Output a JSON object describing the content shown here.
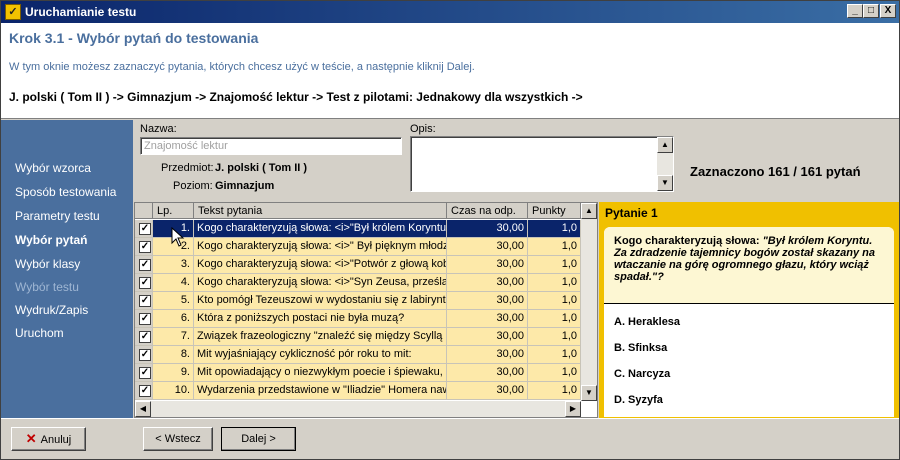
{
  "window": {
    "title": "Uruchamianie testu",
    "controls": [
      "_",
      "□",
      "X"
    ]
  },
  "header": {
    "step_title": "Krok 3.1 - Wybór pytań do testowania",
    "instruction": "W tym oknie możesz zaznaczyć pytania, których chcesz użyć w teście, a następnie kliknij Dalej.",
    "breadcrumb": "J. polski    ( Tom II ) -> Gimnazjum -> Znajomość lektur -> Test z pilotami: Jednakowy dla wszystkich ->"
  },
  "sidebar": {
    "items": [
      {
        "label": "Wybór wzorca",
        "state": "normal"
      },
      {
        "label": "Sposób testowania",
        "state": "normal"
      },
      {
        "label": "Parametry testu",
        "state": "normal"
      },
      {
        "label": "Wybór pytań",
        "state": "active"
      },
      {
        "label": "Wybór klasy",
        "state": "normal"
      },
      {
        "label": "Wybór testu",
        "state": "disabled"
      },
      {
        "label": "Wydruk/Zapis",
        "state": "normal"
      },
      {
        "label": "Uruchom",
        "state": "normal"
      }
    ]
  },
  "form": {
    "name_label": "Nazwa:",
    "name_value": "Znajomość lektur",
    "desc_label": "Opis:",
    "desc_value": "",
    "subject_label": "Przedmiot:",
    "subject_value": "J. polski   ( Tom II )",
    "level_label": "Poziom:",
    "level_value": "Gimnazjum",
    "count_text": "Zaznaczono 161 / 161 pytań"
  },
  "grid": {
    "columns": [
      "Lp.",
      "Tekst pytania",
      "Czas na odp.",
      "Punkty"
    ],
    "selected_row": 0,
    "rows": [
      {
        "checked": true,
        "lp": "1.",
        "text": "Kogo charakteryzują słowa: <i>\"Był królem Koryntu.",
        "time": "30,00",
        "points": "1,0"
      },
      {
        "checked": true,
        "lp": "2.",
        "text": "Kogo charakteryzują słowa: <i>\" Był pięknym młodz",
        "time": "30,00",
        "points": "1,0"
      },
      {
        "checked": true,
        "lp": "3.",
        "text": "Kogo charakteryzują słowa: <i>\"Potwór z głową kob",
        "time": "30,00",
        "points": "1,0"
      },
      {
        "checked": true,
        "lp": "4.",
        "text": "Kogo charakteryzują słowa: <i>\"Syn Zeusa, prześla",
        "time": "30,00",
        "points": "1,0"
      },
      {
        "checked": true,
        "lp": "5.",
        "text": "Kto pomógł Tezeuszowi w wydostaniu się z labiryntu",
        "time": "30,00",
        "points": "1,0"
      },
      {
        "checked": true,
        "lp": "6.",
        "text": "Która z poniższych postaci nie była muzą?",
        "time": "30,00",
        "points": "1,0"
      },
      {
        "checked": true,
        "lp": "7.",
        "text": "Związek frazeologiczny \"znaleźć się między Scyllą a",
        "time": "30,00",
        "points": "1,0"
      },
      {
        "checked": true,
        "lp": "8.",
        "text": "Mit wyjaśniający cykliczność pór roku to mit:",
        "time": "30,00",
        "points": "1,0"
      },
      {
        "checked": true,
        "lp": "9.",
        "text": "Mit opowiadający o niezwykłym poecie i śpiewaku, k",
        "time": "30,00",
        "points": "1,0"
      },
      {
        "checked": true,
        "lp": "10.",
        "text": "Wydarzenia przedstawione w \"Iliadzie\" Homera naw",
        "time": "30,00",
        "points": "1,0"
      }
    ]
  },
  "question_panel": {
    "header": "Pytanie 1",
    "question_plain": "Kogo charakteryzują słowa:",
    "question_italic": "\"Był królem Koryntu. Za zdradzenie tajemnicy bogów został skazany na wtaczanie na górę ogromnego głazu, który wciąż spadał.\"?",
    "answers": [
      "A. Heraklesa",
      "B. Sfinksa",
      "C. Narcyza",
      "D. Syzyfa"
    ]
  },
  "buttons": {
    "cancel": "Anuluj",
    "back": "< Wstecz",
    "next": "Dalej >"
  },
  "colors": {
    "sidebar_bg": "#4a6f9e",
    "row_bg": "#fde9a9",
    "selection": "#0a246a",
    "question_panel_bg": "#f0c000"
  }
}
